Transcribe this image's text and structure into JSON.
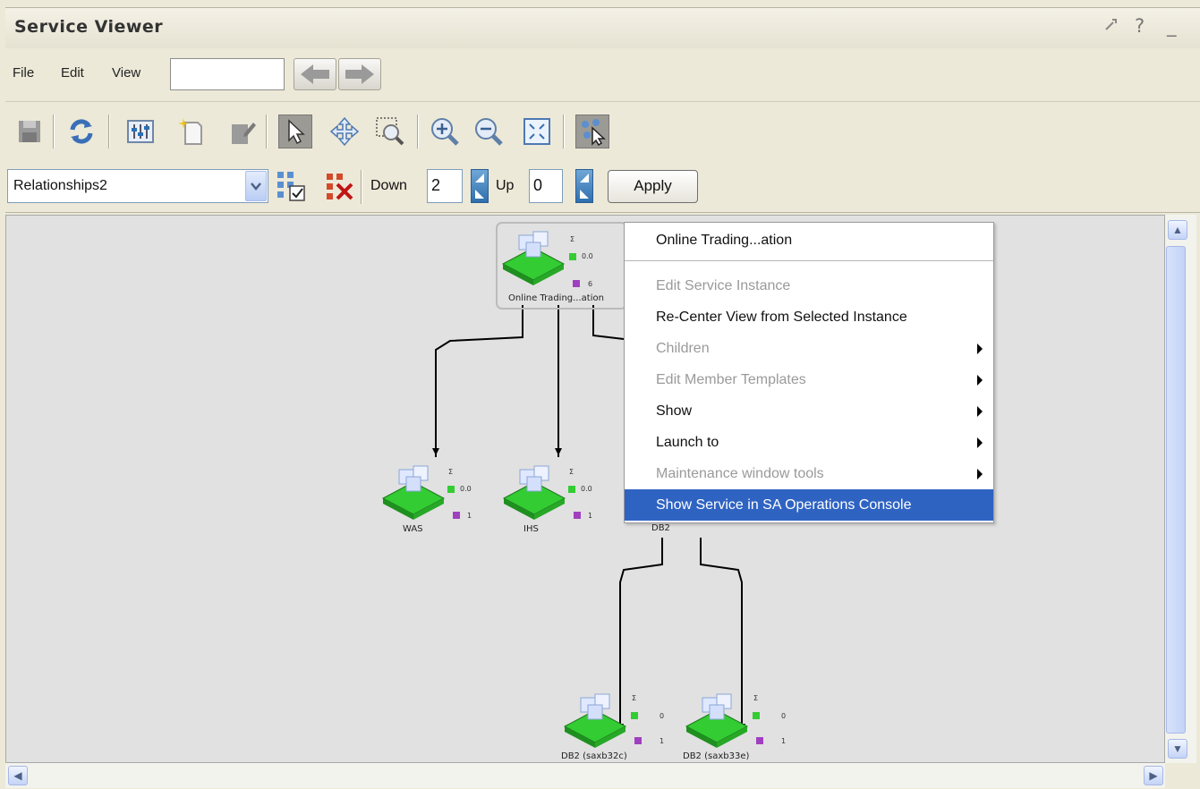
{
  "window": {
    "title": "Service Viewer",
    "controls": {
      "settings_icon": "wrench-icon",
      "help_label": "?",
      "minimize_label": "_"
    }
  },
  "menubar": {
    "items": [
      "File",
      "Edit",
      "View"
    ],
    "search_value": ""
  },
  "toolbar": {
    "icons": [
      "save-icon",
      "refresh-icon",
      "properties-icon",
      "new-instance-icon",
      "edit-instance-icon",
      "select-pointer-icon",
      "pan-icon",
      "zoom-region-icon",
      "zoom-in-icon",
      "zoom-out-icon",
      "fit-to-window-icon",
      "select-overview-icon"
    ]
  },
  "filter": {
    "relationship_value": "Relationships2",
    "down_label": "Down",
    "down_value": "2",
    "up_label": "Up",
    "up_value": "0",
    "apply_label": "Apply"
  },
  "graph": {
    "nodes": [
      {
        "id": "root",
        "label": "Online Trading...ation",
        "metric_value": "0.0",
        "child_count": "6"
      },
      {
        "id": "was",
        "label": "WAS",
        "metric_value": "0.0",
        "child_count": "1"
      },
      {
        "id": "ihs",
        "label": "IHS",
        "metric_value": "0.0",
        "child_count": "1"
      },
      {
        "id": "db2",
        "label": "DB2"
      },
      {
        "id": "db2a",
        "label": "DB2 (saxb32c)",
        "metric_value": "0",
        "child_count": "1"
      },
      {
        "id": "db2b",
        "label": "DB2 (saxb33e)",
        "metric_value": "0",
        "child_count": "1"
      }
    ]
  },
  "context_menu": {
    "header": "Online Trading...ation",
    "items": [
      {
        "label": "Edit Service Instance",
        "enabled": false,
        "submenu": false
      },
      {
        "label": "Re-Center View from Selected Instance",
        "enabled": true,
        "submenu": false
      },
      {
        "label": "Children",
        "enabled": false,
        "submenu": true
      },
      {
        "label": "Edit Member Templates",
        "enabled": false,
        "submenu": true
      },
      {
        "label": "Show",
        "enabled": true,
        "submenu": true
      },
      {
        "label": "Launch to",
        "enabled": true,
        "submenu": true
      },
      {
        "label": "Maintenance window tools",
        "enabled": false,
        "submenu": true
      },
      {
        "label": "Show Service in SA Operations Console",
        "enabled": true,
        "submenu": false,
        "selected": true
      }
    ]
  },
  "colors": {
    "menu_highlight": "#2f63c2",
    "node_base": "#33cc33",
    "canvas_bg": "#e1e1e1"
  }
}
